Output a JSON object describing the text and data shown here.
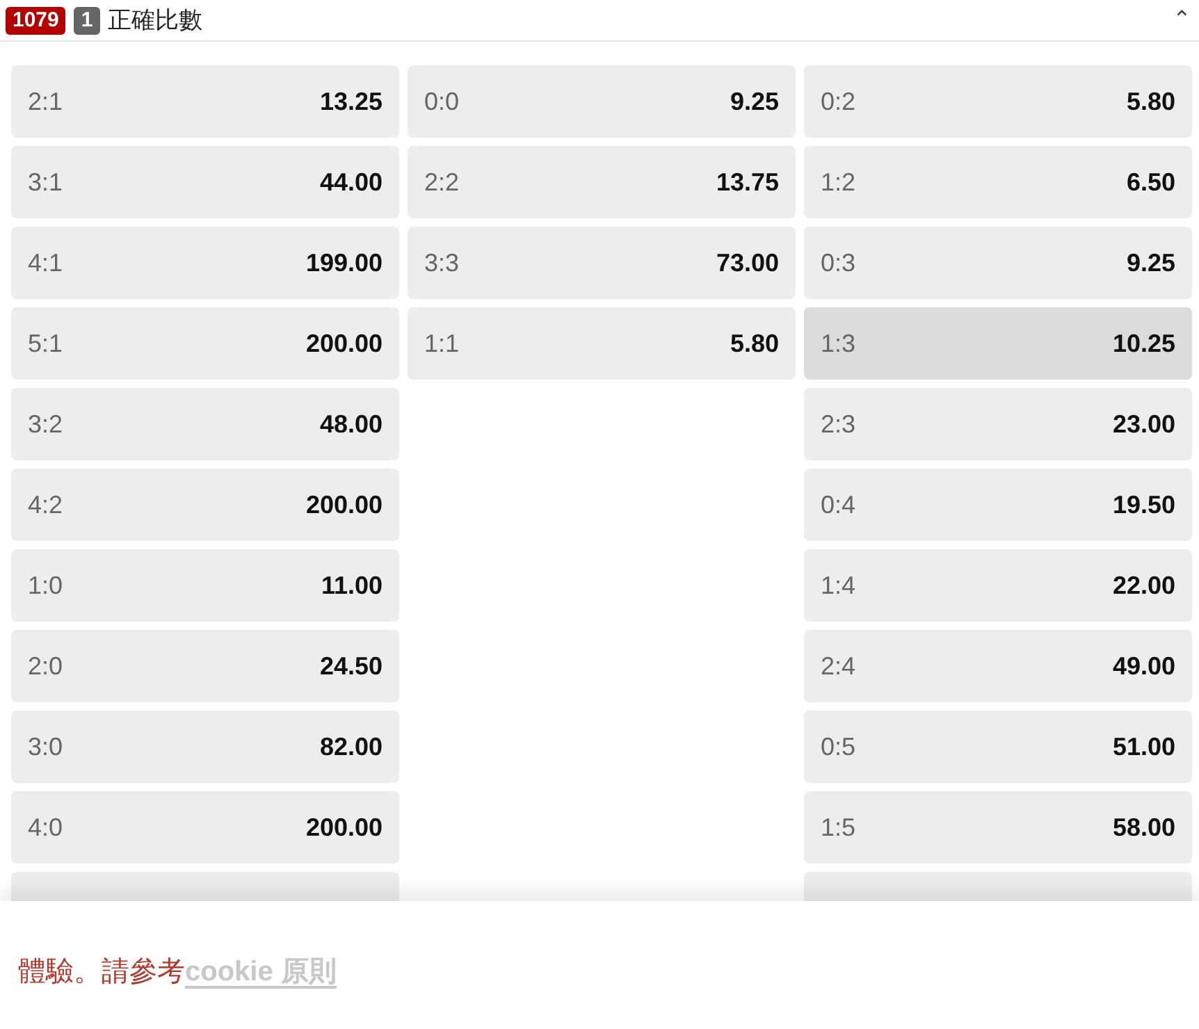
{
  "header": {
    "event_id": "1079",
    "count": "1",
    "title": "正確比數",
    "collapse_icon": "⌃"
  },
  "columns": [
    [
      {
        "score": "2:1",
        "odds": "13.25",
        "hovered": false
      },
      {
        "score": "3:1",
        "odds": "44.00",
        "hovered": false
      },
      {
        "score": "4:1",
        "odds": "199.00",
        "hovered": false
      },
      {
        "score": "5:1",
        "odds": "200.00",
        "hovered": false
      },
      {
        "score": "3:2",
        "odds": "48.00",
        "hovered": false
      },
      {
        "score": "4:2",
        "odds": "200.00",
        "hovered": false
      },
      {
        "score": "1:0",
        "odds": "11.00",
        "hovered": false
      },
      {
        "score": "2:0",
        "odds": "24.50",
        "hovered": false
      },
      {
        "score": "3:0",
        "odds": "82.00",
        "hovered": false
      },
      {
        "score": "4:0",
        "odds": "200.00",
        "hovered": false
      }
    ],
    [
      {
        "score": "0:0",
        "odds": "9.25",
        "hovered": false
      },
      {
        "score": "2:2",
        "odds": "13.75",
        "hovered": false
      },
      {
        "score": "3:3",
        "odds": "73.00",
        "hovered": false
      },
      {
        "score": "1:1",
        "odds": "5.80",
        "hovered": false
      }
    ],
    [
      {
        "score": "0:2",
        "odds": "5.80",
        "hovered": false
      },
      {
        "score": "1:2",
        "odds": "6.50",
        "hovered": false
      },
      {
        "score": "0:3",
        "odds": "9.25",
        "hovered": false
      },
      {
        "score": "1:3",
        "odds": "10.25",
        "hovered": true
      },
      {
        "score": "2:3",
        "odds": "23.00",
        "hovered": false
      },
      {
        "score": "0:4",
        "odds": "19.50",
        "hovered": false
      },
      {
        "score": "1:4",
        "odds": "22.00",
        "hovered": false
      },
      {
        "score": "2:4",
        "odds": "49.00",
        "hovered": false
      },
      {
        "score": "0:5",
        "odds": "51.00",
        "hovered": false
      },
      {
        "score": "1:5",
        "odds": "58.00",
        "hovered": false
      }
    ]
  ],
  "cookie_banner": {
    "text": "體驗。請參考",
    "link": "cookie 原則"
  }
}
